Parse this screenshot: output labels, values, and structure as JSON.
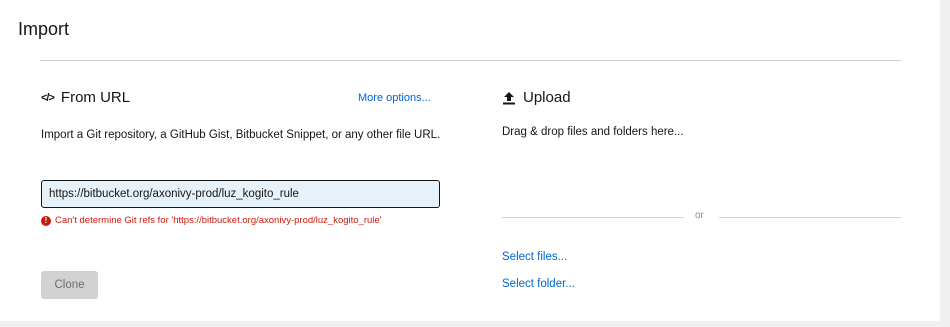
{
  "page": {
    "title": "Import"
  },
  "from_url": {
    "icon": "code-icon",
    "icon_glyph": "</>",
    "heading": "From URL",
    "more_options": "More options...",
    "description": "Import a Git repository, a GitHub Gist, Bitbucket Snippet, or any other file URL.",
    "input_value": "https://bitbucket.org/axonivy-prod/luz_kogito_rule",
    "error": "Can't determine Git refs for 'https://bitbucket.org/axonivy-prod/luz_kogito_rule'",
    "error_icon_glyph": "!",
    "clone_label": "Clone"
  },
  "upload": {
    "icon": "upload-icon",
    "heading": "Upload",
    "drop_text": "Drag & drop files and folders here...",
    "or_text": "or",
    "select_files": "Select files...",
    "select_folder": "Select folder..."
  },
  "colors": {
    "link": "#0066cc",
    "error": "#c9190b",
    "input_bg": "#e7f1fa",
    "disabled_button": "#d2d2d2"
  }
}
